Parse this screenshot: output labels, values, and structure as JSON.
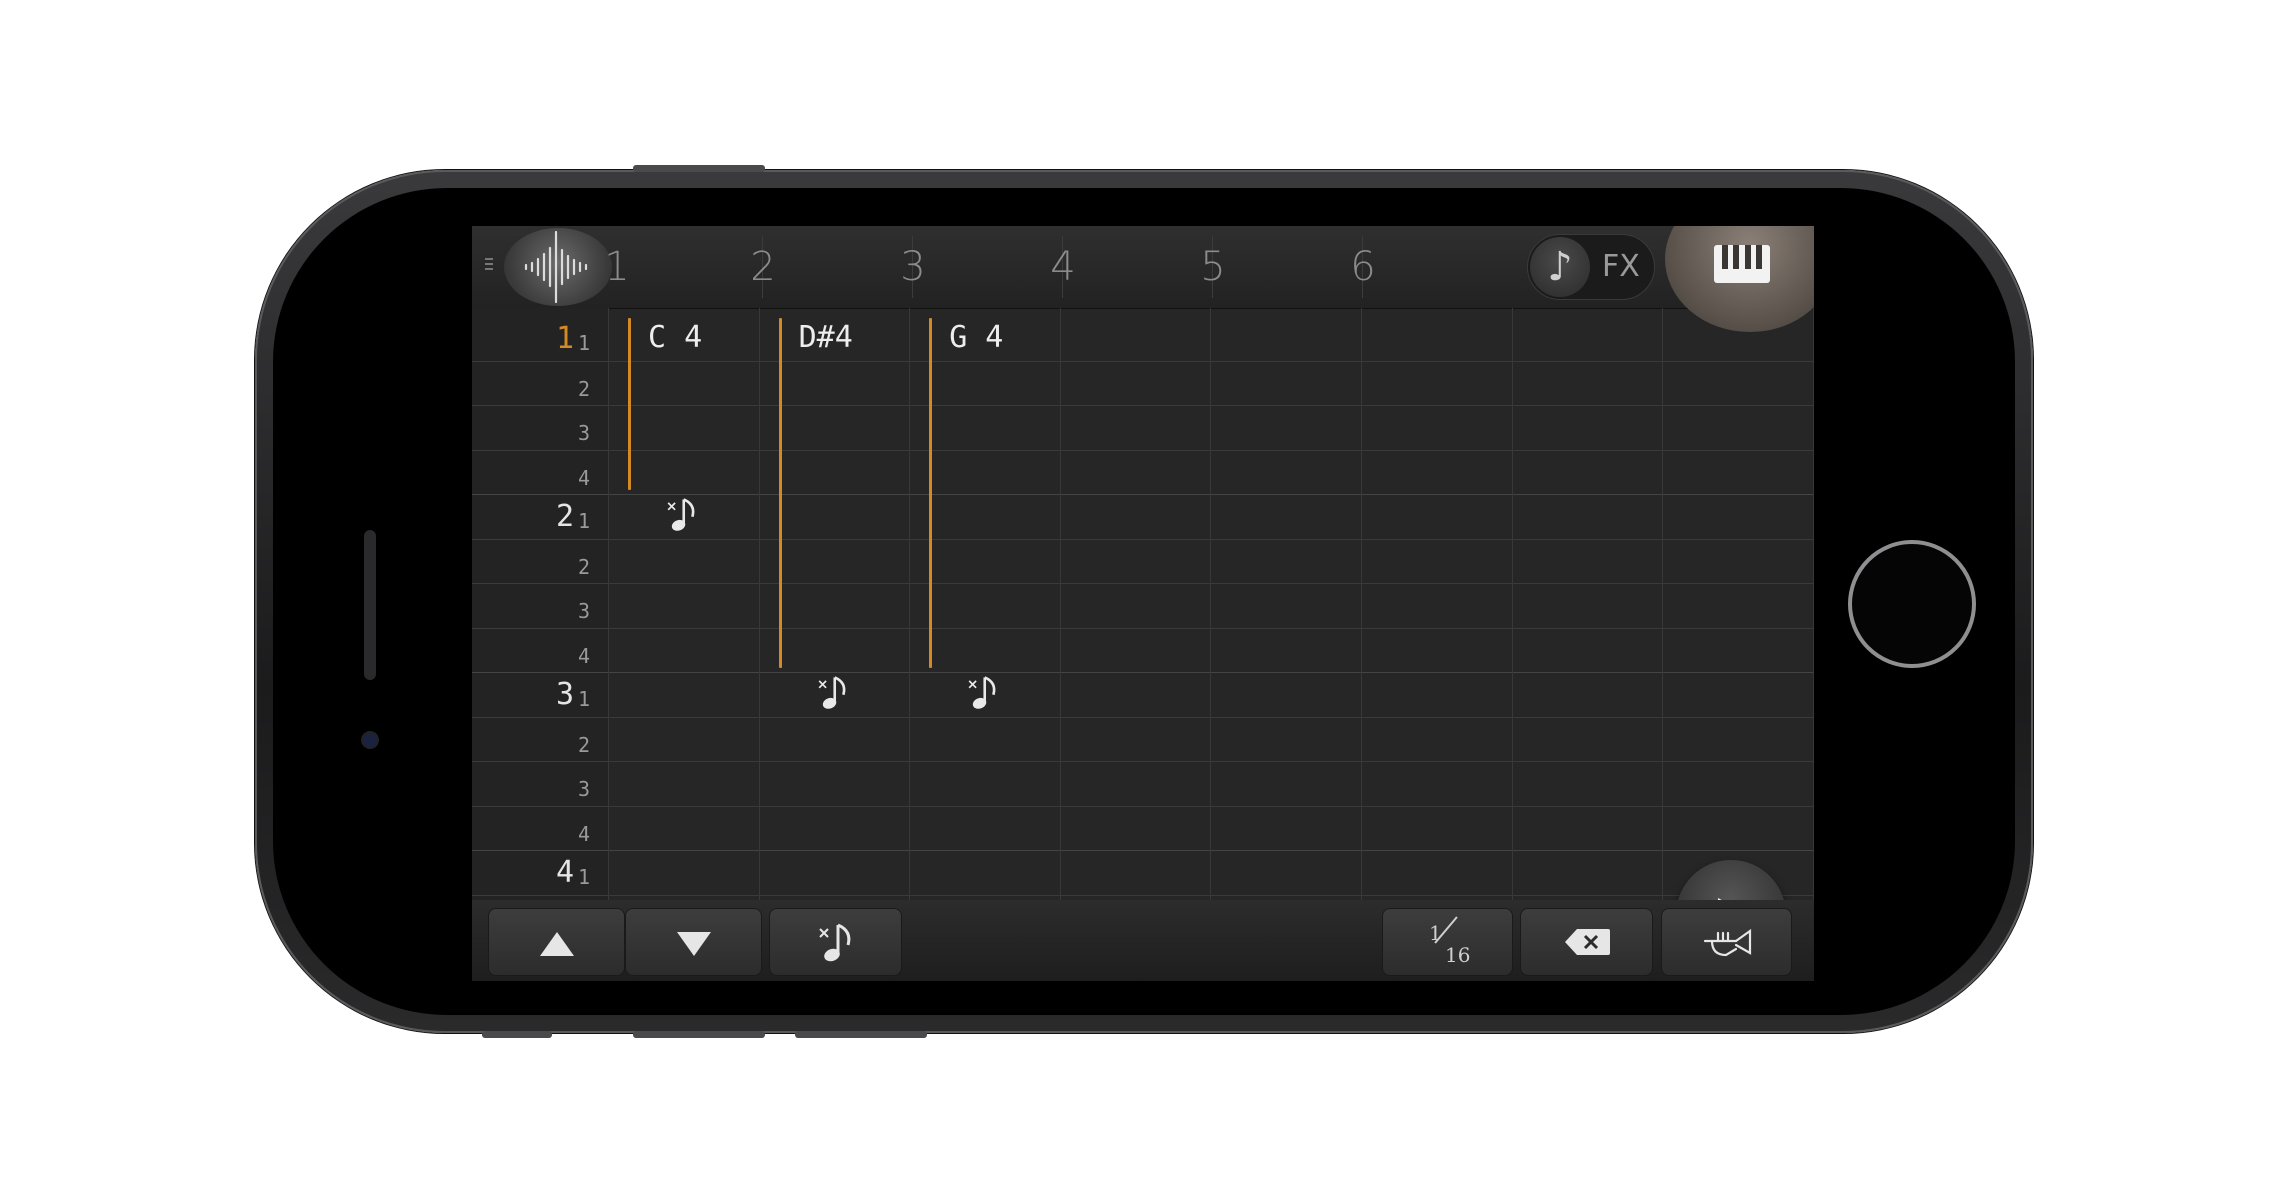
{
  "top_bar": {
    "columns": [
      "1",
      "2",
      "3",
      "4",
      "5",
      "6"
    ],
    "fx_label": "FX",
    "note_icon": "eighth-note-icon",
    "piano_icon": "piano-keys-icon",
    "wave_icon": "waveform-icon"
  },
  "rows": [
    {
      "beat": "1",
      "sub": "1"
    },
    {
      "sub": "2"
    },
    {
      "sub": "3"
    },
    {
      "sub": "4"
    },
    {
      "beat": "2",
      "sub": "1"
    },
    {
      "sub": "2"
    },
    {
      "sub": "3"
    },
    {
      "sub": "4"
    },
    {
      "beat": "3",
      "sub": "1"
    },
    {
      "sub": "2"
    },
    {
      "sub": "3"
    },
    {
      "sub": "4"
    },
    {
      "beat": "4",
      "sub": "1"
    }
  ],
  "notes": [
    {
      "column": 1,
      "label": "C 4",
      "length_rows": 4
    },
    {
      "column": 2,
      "label": "D#4",
      "length_rows": 8
    },
    {
      "column": 3,
      "label": "G 4",
      "length_rows": 8
    }
  ],
  "rests": [
    {
      "column": 1,
      "row": 5
    },
    {
      "column": 2,
      "row": 9
    },
    {
      "column": 3,
      "row": 9
    }
  ],
  "toolbar": {
    "step_fraction_numerator": "1",
    "step_fraction_denominator": "16",
    "buttons": [
      "up-arrow-icon",
      "down-arrow-icon",
      "note-off-icon",
      "step-size",
      "backspace-icon",
      "trumpet-icon"
    ]
  },
  "colors": {
    "accent": "#d48a24",
    "background": "#262626"
  }
}
